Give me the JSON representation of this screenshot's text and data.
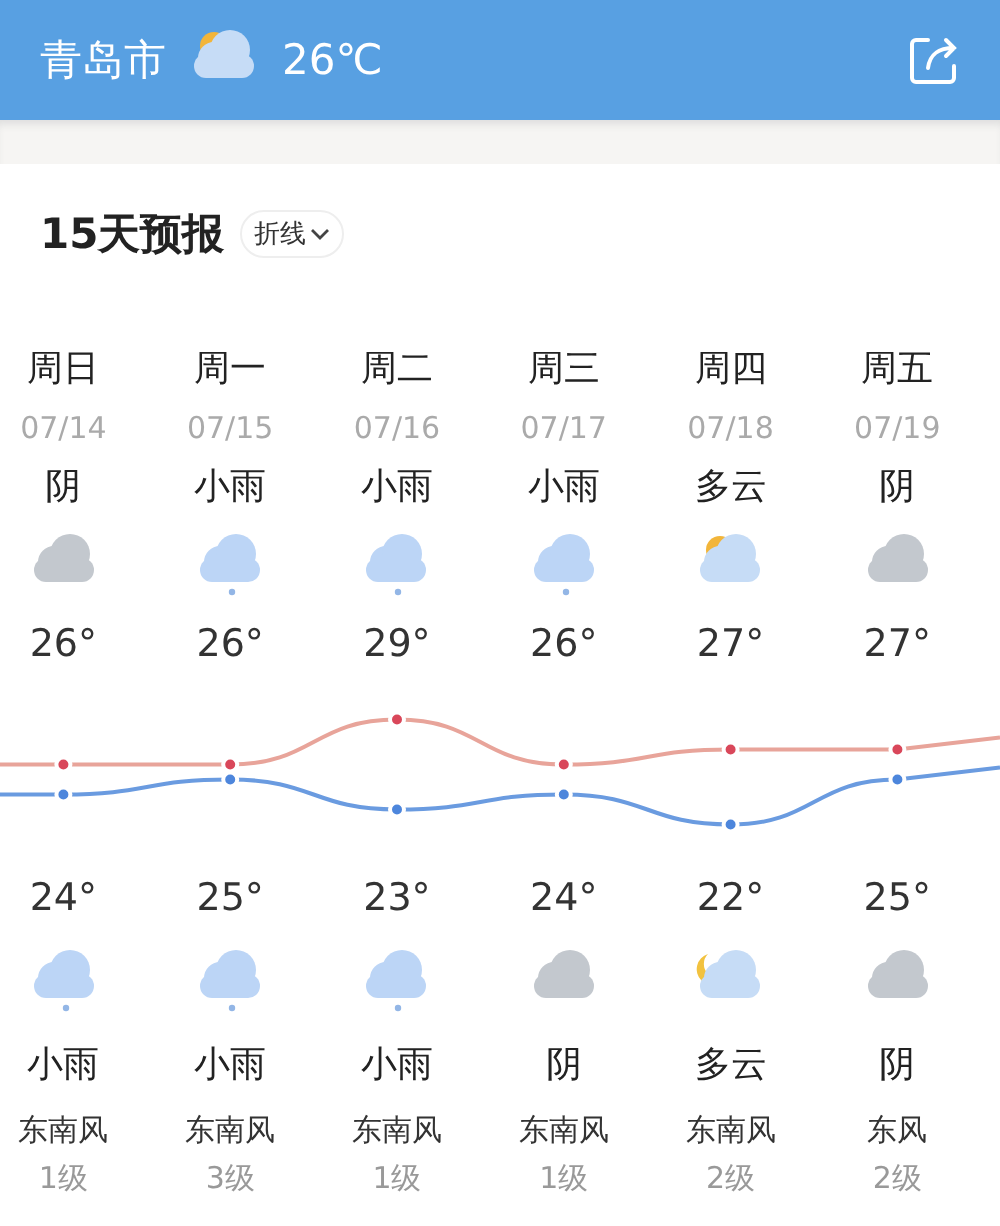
{
  "header": {
    "city": "青岛市",
    "weather_icon": {
      "kind": "partly-cloudy"
    },
    "temperature": "26℃"
  },
  "forecast": {
    "title": "15天预报",
    "view_toggle": "折线",
    "days": [
      {
        "weekday": "周日",
        "date": "07/14",
        "day_condition": "阴",
        "day_icon": {
          "kind": "overcast"
        },
        "high": "26°",
        "low": "24°",
        "night_icon": {
          "kind": "rain"
        },
        "night_condition": "小雨",
        "wind": "东南风",
        "wind_level": "1级"
      },
      {
        "weekday": "周一",
        "date": "07/15",
        "day_condition": "小雨",
        "day_icon": {
          "kind": "rain"
        },
        "high": "26°",
        "low": "25°",
        "night_icon": {
          "kind": "rain"
        },
        "night_condition": "小雨",
        "wind": "东南风",
        "wind_level": "3级"
      },
      {
        "weekday": "周二",
        "date": "07/16",
        "day_condition": "小雨",
        "day_icon": {
          "kind": "rain"
        },
        "high": "29°",
        "low": "23°",
        "night_icon": {
          "kind": "rain"
        },
        "night_condition": "小雨",
        "wind": "东南风",
        "wind_level": "1级"
      },
      {
        "weekday": "周三",
        "date": "07/17",
        "day_condition": "小雨",
        "day_icon": {
          "kind": "rain"
        },
        "high": "26°",
        "low": "24°",
        "night_icon": {
          "kind": "overcast"
        },
        "night_condition": "阴",
        "wind": "东南风",
        "wind_level": "1级"
      },
      {
        "weekday": "周四",
        "date": "07/18",
        "day_condition": "多云",
        "day_icon": {
          "kind": "partly-cloudy"
        },
        "high": "27°",
        "low": "22°",
        "night_icon": {
          "kind": "cloudy-night"
        },
        "night_condition": "多云",
        "wind": "东南风",
        "wind_level": "2级"
      },
      {
        "weekday": "周五",
        "date": "07/19",
        "day_condition": "阴",
        "day_icon": {
          "kind": "overcast"
        },
        "high": "27°",
        "low": "25°",
        "night_icon": {
          "kind": "overcast"
        },
        "night_condition": "阴",
        "wind": "东风",
        "wind_level": "2级"
      }
    ]
  }
}
